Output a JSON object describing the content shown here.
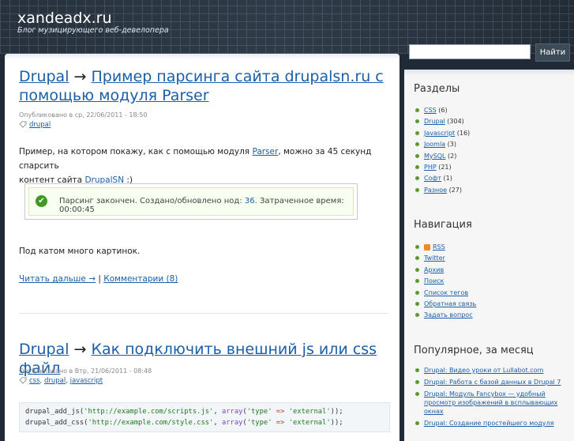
{
  "header": {
    "site_title": "xandeadx.ru",
    "site_description": "Блог музицирующего веб-девелопера",
    "search_placeholder": "",
    "search_button": "Найти"
  },
  "posts": [
    {
      "title_category": "Drupal",
      "arrow": "→",
      "title_line1": "Пример парсинга сайта drupalsn.ru с",
      "title_line2": "помощью модуля Parser",
      "meta": "Опубликовано в ср, 22/06/2011 - 18:50",
      "tags": [
        "drupal"
      ],
      "body_part1": "Пример, на котором покажу, как с помощью модуля ",
      "body_link1": "Parser",
      "body_part2": ", можно за 45 секунд спарсить",
      "body_part3": "контент сайта ",
      "body_link2": "DrupalSN",
      "body_part4": " :)",
      "message_part1": "Парсинг закончен. Создано/обновлено нод: ",
      "message_count": "36",
      "message_part2": ". Затраченное время: 00:00:45",
      "teaser": "Под катом много картинок.",
      "read_more": "Читать дальше →",
      "separator": "|",
      "comments": "Комментарии (8)"
    },
    {
      "title_category": "Drupal",
      "arrow": "→",
      "title_line1": "Как подключить внешний js или css файл",
      "meta": "Опубликовано в Втр, 21/06/2011 - 08:48",
      "tags": [
        "css",
        "drupal",
        "javascript"
      ],
      "code": [
        {
          "fn": "drupal_add_js(",
          "url": "'http://example.com/scripts.js'",
          "mid": ", ",
          "kw": "array",
          "p1": "(",
          "key": "'type'",
          "op": " => ",
          "val": "'external'",
          "end": "));"
        },
        {
          "fn": "drupal_add_css(",
          "url": "'http://example.com/style.css'",
          "mid": ", ",
          "kw": "array",
          "p1": "(",
          "key": "'type'",
          "op": " => ",
          "val": "'external'",
          "end": "));"
        }
      ]
    }
  ],
  "sidebar": {
    "sections": {
      "title": "Разделы",
      "items": [
        {
          "label": "CSS",
          "count": "(6)"
        },
        {
          "label": "Drupal",
          "count": "(304)"
        },
        {
          "label": "Javascript",
          "count": "(16)"
        },
        {
          "label": "Joomla",
          "count": "(3)"
        },
        {
          "label": "MySQL",
          "count": "(2)"
        },
        {
          "label": "PHP",
          "count": "(21)"
        },
        {
          "label": "Софт",
          "count": "(1)"
        },
        {
          "label": "Разное",
          "count": "(27)"
        }
      ]
    },
    "navigation": {
      "title": "Навигация",
      "items": [
        "RSS",
        "Twitter",
        "Архив",
        "Поиск",
        "Список тегов",
        "Обратная связь",
        "Задать вопрос"
      ]
    },
    "popular": {
      "title": "Популярное, за месяц",
      "items": [
        "Drupal: Видео уроки от Lullabot.com",
        "Drupal: Работа с базой данных в Drupal 7",
        "Drupal: Модуль Fancybox — удобный просмотр изображений в всплывающих окнах",
        "Drupal: Создание простейшего модуля"
      ]
    }
  },
  "colors": {
    "link": "#1a5fa8",
    "header_bg": "#26313d",
    "success_green": "#3e9a24",
    "bullet_green": "#5a9a2a"
  }
}
